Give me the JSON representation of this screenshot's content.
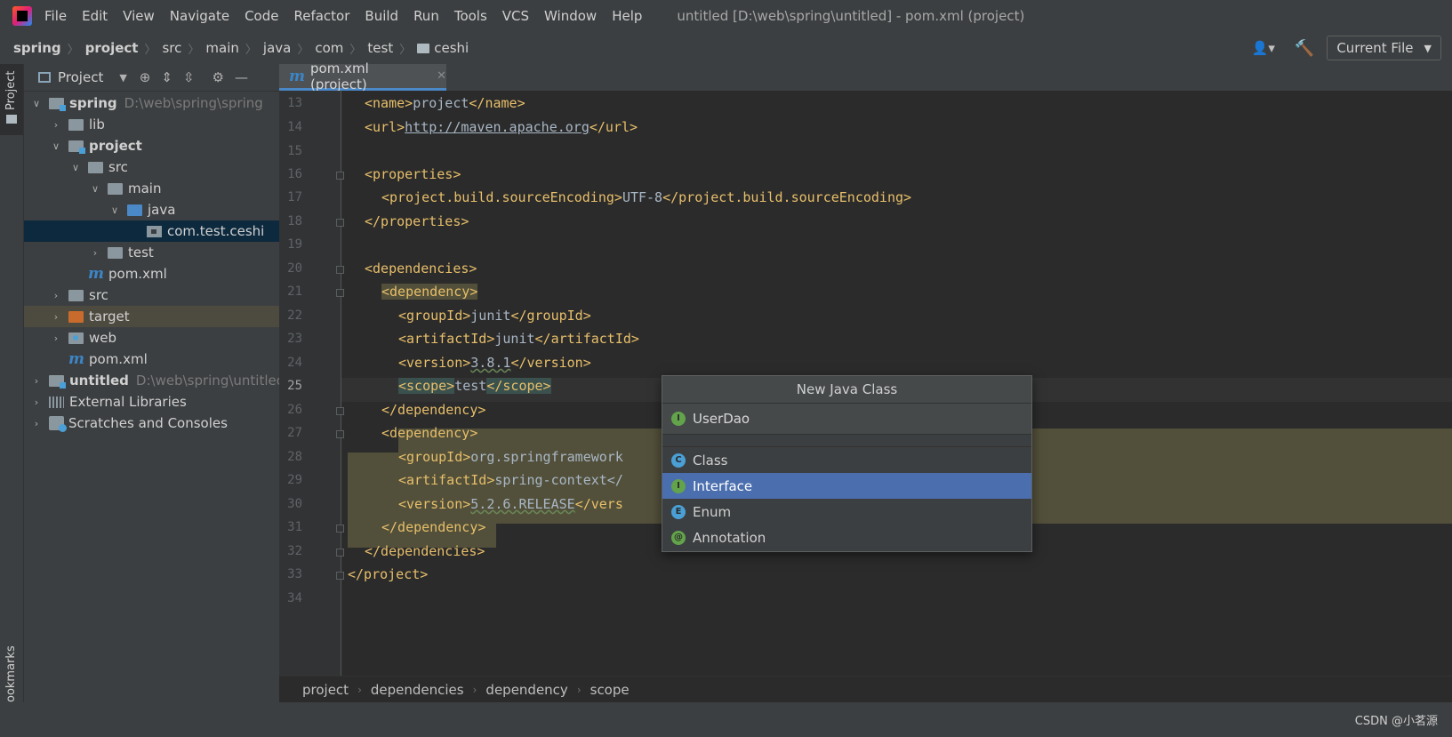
{
  "menubar": {
    "items": [
      "File",
      "Edit",
      "View",
      "Navigate",
      "Code",
      "Refactor",
      "Build",
      "Run",
      "Tools",
      "VCS",
      "Window",
      "Help"
    ],
    "title": "untitled [D:\\web\\spring\\untitled] - pom.xml (project)"
  },
  "navbar": {
    "crumbs": [
      "spring",
      "project",
      "src",
      "main",
      "java",
      "com",
      "test",
      "ceshi"
    ],
    "run_config": "Current File"
  },
  "leftstrip": {
    "project_tab": "Project",
    "bookmarks_tab": "ookmarks"
  },
  "project_panel": {
    "title": "Project",
    "tree": [
      {
        "name": "spring",
        "path": "D:\\web\\spring\\spring"
      },
      {
        "name": "lib"
      },
      {
        "name": "project"
      },
      {
        "name": "src"
      },
      {
        "name": "main"
      },
      {
        "name": "java"
      },
      {
        "name": "com.test.ceshi"
      },
      {
        "name": "test"
      },
      {
        "name": "pom.xml"
      },
      {
        "name": "src"
      },
      {
        "name": "target"
      },
      {
        "name": "web"
      },
      {
        "name": "pom.xml"
      },
      {
        "name": "untitled",
        "path": "D:\\web\\spring\\untitled"
      },
      {
        "name": "External Libraries"
      },
      {
        "name": "Scratches and Consoles"
      }
    ]
  },
  "editor": {
    "tab_label": "pom.xml (project)",
    "line_numbers": [
      "13",
      "14",
      "15",
      "16",
      "17",
      "18",
      "19",
      "20",
      "21",
      "22",
      "23",
      "24",
      "25",
      "26",
      "27",
      "28",
      "29",
      "30",
      "31",
      "32",
      "33",
      "34"
    ],
    "current_line": "25",
    "code": {
      "l13_open": "<name>",
      "l13_text": "project",
      "l13_close": "</name>",
      "l14_open": "<url>",
      "l14_text": "http://maven.apache.org",
      "l14_close": "</url>",
      "l16": "<properties>",
      "l17_open": "<project.build.sourceEncoding>",
      "l17_text": "UTF-8",
      "l17_close": "</project.build.sourceEncoding>",
      "l18": "</properties>",
      "l20": "<dependencies>",
      "l21": "<dependency>",
      "l22_open": "<groupId>",
      "l22_text": "junit",
      "l22_close": "</groupId>",
      "l23_open": "<artifactId>",
      "l23_text": "junit",
      "l23_close": "</artifactId>",
      "l24_open": "<version>",
      "l24_text": "3.8.1",
      "l24_close": "</version>",
      "l25_open": "<scope>",
      "l25_text": "test",
      "l25_close": "</scope>",
      "l26": "</dependency>",
      "l27": "<dependency>",
      "l28_open": "<groupId>",
      "l28_text": "org.springframework",
      "l29_open": "<artifactId>",
      "l29_text": "spring-context</",
      "l30_open": "<version>",
      "l30_text": "5.2.6.RELEASE",
      "l30_close": "</vers",
      "l31": "</dependency>",
      "l32": "</dependencies>",
      "l33": "</project>"
    }
  },
  "editor_crumbs": [
    "project",
    "dependencies",
    "dependency",
    "scope"
  ],
  "popup": {
    "title": "New Java Class",
    "input_value": "UserDao",
    "options": [
      {
        "label": "Class",
        "icon": "C"
      },
      {
        "label": "Interface",
        "icon": "I"
      },
      {
        "label": "Enum",
        "icon": "E"
      },
      {
        "label": "Annotation",
        "icon": "@"
      }
    ],
    "selected": "Interface",
    "input_icon": "I"
  },
  "watermark": "CSDN @小茗源",
  "colors": {
    "accent": "#4b6eaf",
    "tag": "#e8bf6a",
    "selection": "#0d293e"
  }
}
